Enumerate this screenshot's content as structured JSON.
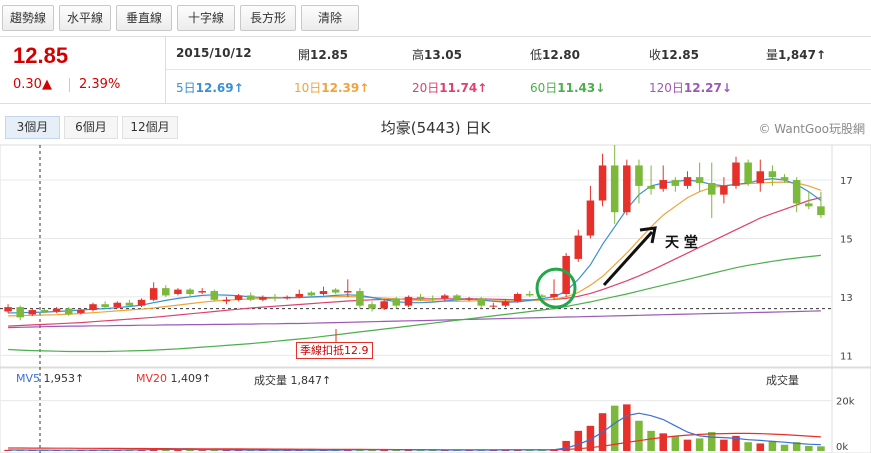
{
  "toolbar": {
    "buttons": [
      "趨勢線",
      "水平線",
      "垂直線",
      "十字線",
      "長方形",
      "清除"
    ]
  },
  "quote": {
    "price": "12.85",
    "change": "0.30▲",
    "change_pct": "2.39%",
    "date": "2015/10/12",
    "open_label": "開",
    "open": "12.85",
    "high_label": "高",
    "high": "13.05",
    "low_label": "低",
    "low": "12.80",
    "close_label": "收",
    "close": "12.85",
    "volume_label": "量",
    "volume": "1,847↑",
    "ma5_label": "5日",
    "ma5": "12.69↑",
    "ma10_label": "10日",
    "ma10": "12.39↑",
    "ma20_label": "20日",
    "ma20": "11.74↑",
    "ma60_label": "60日",
    "ma60": "11.43↓",
    "ma120_label": "120日",
    "ma120": "12.27↓"
  },
  "periods": [
    "3個月",
    "6個月",
    "12個月"
  ],
  "chart_title": "均豪(5443) 日K",
  "watermark": "© WantGoo玩股網",
  "colors": {
    "up": "#e8302a",
    "down": "#7cb83a",
    "ma5": "#3a8fd6",
    "ma10": "#f0a33a",
    "ma20": "#e0406e",
    "ma60": "#4cae4c",
    "ma120": "#9b59b6",
    "vol_ma5": "#3a6fd6",
    "vol_ma20": "#e8302a"
  },
  "chart_data": {
    "type": "candlestick",
    "y_ticks": [
      11,
      13,
      15,
      17
    ],
    "ylim": [
      10.6,
      18.2
    ],
    "vol_ticks": [
      "20k",
      "0k"
    ],
    "vol_max": 25000,
    "candles": [
      [
        12.5,
        12.75,
        12.45,
        12.65
      ],
      [
        12.65,
        12.7,
        12.2,
        12.3
      ],
      [
        12.4,
        12.6,
        12.35,
        12.55
      ],
      [
        12.55,
        12.6,
        12.45,
        12.5
      ],
      [
        12.5,
        12.65,
        12.45,
        12.6
      ],
      [
        12.6,
        12.65,
        12.35,
        12.4
      ],
      [
        12.45,
        12.6,
        12.4,
        12.55
      ],
      [
        12.55,
        12.8,
        12.5,
        12.75
      ],
      [
        12.75,
        12.85,
        12.6,
        12.65
      ],
      [
        12.65,
        12.85,
        12.6,
        12.8
      ],
      [
        12.8,
        12.9,
        12.65,
        12.7
      ],
      [
        12.7,
        12.95,
        12.65,
        12.9
      ],
      [
        12.9,
        13.5,
        12.85,
        13.3
      ],
      [
        13.3,
        13.4,
        13.0,
        13.05
      ],
      [
        13.1,
        13.3,
        13.05,
        13.25
      ],
      [
        13.25,
        13.3,
        13.0,
        13.1
      ],
      [
        13.15,
        13.3,
        13.1,
        13.2
      ],
      [
        13.2,
        13.25,
        12.85,
        12.9
      ],
      [
        12.85,
        13.0,
        12.75,
        12.9
      ],
      [
        12.9,
        13.1,
        12.85,
        13.05
      ],
      [
        13.05,
        13.15,
        12.85,
        12.9
      ],
      [
        12.9,
        13.05,
        12.85,
        13.0
      ],
      [
        13.0,
        13.1,
        12.85,
        12.95
      ],
      [
        12.95,
        13.05,
        12.9,
        13.0
      ],
      [
        13.0,
        13.25,
        12.95,
        13.1
      ],
      [
        13.15,
        13.2,
        13.0,
        13.05
      ],
      [
        13.1,
        13.35,
        13.05,
        13.2
      ],
      [
        13.25,
        13.3,
        13.1,
        13.15
      ],
      [
        13.15,
        13.6,
        13.0,
        13.2
      ],
      [
        13.2,
        13.3,
        12.6,
        12.7
      ],
      [
        12.75,
        12.85,
        12.5,
        12.6
      ],
      [
        12.6,
        12.9,
        12.55,
        12.85
      ],
      [
        12.95,
        13.0,
        12.6,
        12.7
      ],
      [
        12.7,
        13.05,
        12.65,
        13.0
      ],
      [
        13.0,
        13.1,
        12.85,
        12.95
      ],
      [
        12.95,
        13.05,
        12.8,
        12.9
      ],
      [
        12.95,
        13.1,
        12.85,
        13.05
      ],
      [
        13.05,
        13.1,
        12.85,
        12.9
      ],
      [
        12.9,
        13.0,
        12.85,
        12.95
      ],
      [
        12.95,
        13.0,
        12.6,
        12.7
      ],
      [
        12.7,
        12.8,
        12.6,
        12.7
      ],
      [
        12.7,
        12.9,
        12.65,
        12.85
      ],
      [
        12.85,
        13.15,
        12.8,
        13.1
      ],
      [
        13.1,
        13.2,
        13.0,
        13.05
      ],
      [
        13.05,
        13.1,
        12.95,
        13.0
      ],
      [
        13.0,
        13.6,
        12.9,
        13.1
      ],
      [
        13.1,
        14.5,
        13.0,
        14.4
      ],
      [
        14.3,
        15.3,
        14.2,
        15.1
      ],
      [
        15.1,
        16.8,
        15.0,
        16.3
      ],
      [
        16.3,
        17.9,
        16.1,
        17.5
      ],
      [
        17.5,
        18.2,
        15.5,
        15.9
      ],
      [
        15.9,
        17.7,
        15.8,
        17.5
      ],
      [
        17.5,
        17.7,
        16.2,
        16.8
      ],
      [
        16.8,
        17.5,
        16.5,
        16.7
      ],
      [
        16.7,
        17.5,
        16.6,
        17.0
      ],
      [
        17.0,
        17.1,
        16.6,
        16.8
      ],
      [
        16.8,
        17.3,
        16.7,
        17.1
      ],
      [
        17.1,
        17.6,
        16.6,
        16.9
      ],
      [
        16.9,
        17.6,
        15.7,
        16.5
      ],
      [
        16.5,
        17.1,
        16.2,
        16.8
      ],
      [
        16.8,
        17.8,
        16.7,
        17.6
      ],
      [
        17.6,
        17.7,
        16.8,
        16.9
      ],
      [
        16.9,
        17.7,
        16.6,
        17.3
      ],
      [
        17.3,
        17.5,
        16.8,
        17.1
      ],
      [
        17.1,
        17.2,
        16.9,
        17.0
      ],
      [
        17.0,
        17.1,
        15.9,
        16.2
      ],
      [
        16.2,
        16.6,
        16.0,
        16.1
      ],
      [
        16.1,
        16.6,
        15.7,
        15.8
      ]
    ],
    "volumes": [
      450,
      380,
      300,
      250,
      350,
      320,
      300,
      420,
      380,
      350,
      420,
      600,
      900,
      800,
      500,
      400,
      300,
      500,
      400,
      300,
      350,
      380,
      300,
      320,
      400,
      350,
      380,
      350,
      600,
      700,
      500,
      450,
      550,
      500,
      350,
      350,
      380,
      400,
      350,
      500,
      400,
      420,
      500,
      450,
      380,
      700,
      4000,
      8000,
      10000,
      15000,
      18000,
      18500,
      12000,
      8000,
      7000,
      6000,
      4500,
      5000,
      7500,
      4500,
      6000,
      3500,
      3000,
      4000,
      2500,
      3500,
      2000,
      1847
    ],
    "ma5": [
      12.45,
      12.46,
      12.47,
      12.48,
      12.5,
      12.52,
      12.55,
      12.58,
      12.6,
      12.63,
      12.67,
      12.72,
      12.8,
      12.88,
      12.95,
      13.0,
      13.05,
      13.07,
      13.06,
      13.04,
      13.0,
      12.98,
      12.97,
      12.97,
      12.98,
      13.0,
      13.02,
      13.05,
      13.07,
      13.05,
      12.98,
      12.9,
      12.84,
      12.8,
      12.8,
      12.82,
      12.86,
      12.9,
      12.93,
      12.9,
      12.85,
      12.82,
      12.83,
      12.88,
      12.94,
      13.0,
      13.2,
      13.6,
      14.1,
      14.8,
      15.4,
      16.0,
      16.5,
      16.8,
      16.9,
      16.95,
      17.0,
      16.95,
      16.85,
      16.8,
      16.85,
      16.9,
      17.0,
      17.05,
      17.0,
      16.85,
      16.6,
      16.3
    ],
    "ma10": [
      12.35,
      12.36,
      12.37,
      12.38,
      12.39,
      12.41,
      12.43,
      12.46,
      12.49,
      12.52,
      12.55,
      12.58,
      12.62,
      12.67,
      12.72,
      12.77,
      12.82,
      12.86,
      12.89,
      12.91,
      12.93,
      12.95,
      12.96,
      12.97,
      12.98,
      12.99,
      13.0,
      13.01,
      13.01,
      13.0,
      12.98,
      12.96,
      12.93,
      12.9,
      12.88,
      12.86,
      12.85,
      12.85,
      12.86,
      12.87,
      12.87,
      12.86,
      12.86,
      12.87,
      12.89,
      12.92,
      13.0,
      13.15,
      13.4,
      13.7,
      14.1,
      14.5,
      14.95,
      15.4,
      15.8,
      16.1,
      16.4,
      16.6,
      16.75,
      16.8,
      16.85,
      16.88,
      16.9,
      16.92,
      16.93,
      16.9,
      16.8,
      16.65
    ],
    "ma20": [
      12.0,
      12.02,
      12.04,
      12.06,
      12.08,
      12.1,
      12.12,
      12.15,
      12.18,
      12.21,
      12.24,
      12.27,
      12.3,
      12.34,
      12.38,
      12.42,
      12.46,
      12.5,
      12.54,
      12.58,
      12.62,
      12.65,
      12.68,
      12.71,
      12.74,
      12.77,
      12.8,
      12.83,
      12.86,
      12.88,
      12.9,
      12.91,
      12.92,
      12.93,
      12.93,
      12.93,
      12.93,
      12.93,
      12.93,
      12.93,
      12.92,
      12.91,
      12.9,
      12.9,
      12.9,
      12.91,
      12.95,
      13.02,
      13.12,
      13.25,
      13.4,
      13.55,
      13.72,
      13.9,
      14.1,
      14.3,
      14.5,
      14.7,
      14.9,
      15.1,
      15.3,
      15.5,
      15.7,
      15.85,
      16.0,
      16.15,
      16.3,
      16.4
    ],
    "ma60": [
      11.2,
      11.18,
      11.16,
      11.15,
      11.14,
      11.13,
      11.13,
      11.13,
      11.13,
      11.14,
      11.15,
      11.16,
      11.18,
      11.2,
      11.22,
      11.25,
      11.28,
      11.31,
      11.34,
      11.37,
      11.4,
      11.44,
      11.48,
      11.52,
      11.56,
      11.6,
      11.65,
      11.7,
      11.75,
      11.8,
      11.85,
      11.9,
      11.95,
      12.0,
      12.05,
      12.1,
      12.15,
      12.2,
      12.25,
      12.3,
      12.35,
      12.4,
      12.45,
      12.5,
      12.55,
      12.6,
      12.67,
      12.75,
      12.83,
      12.92,
      13.01,
      13.1,
      13.2,
      13.3,
      13.4,
      13.5,
      13.6,
      13.7,
      13.8,
      13.9,
      14.0,
      14.08,
      14.15,
      14.22,
      14.28,
      14.33,
      14.38,
      14.42
    ],
    "ma120": [
      11.95,
      11.96,
      11.97,
      11.98,
      11.99,
      12.0,
      12.0,
      12.01,
      12.01,
      12.02,
      12.02,
      12.03,
      12.03,
      12.04,
      12.04,
      12.05,
      12.05,
      12.06,
      12.06,
      12.07,
      12.07,
      12.08,
      12.08,
      12.09,
      12.09,
      12.1,
      12.11,
      12.12,
      12.13,
      12.14,
      12.15,
      12.16,
      12.17,
      12.18,
      12.19,
      12.2,
      12.21,
      12.22,
      12.23,
      12.24,
      12.25,
      12.26,
      12.27,
      12.28,
      12.29,
      12.3,
      12.31,
      12.32,
      12.33,
      12.34,
      12.35,
      12.36,
      12.37,
      12.38,
      12.39,
      12.4,
      12.41,
      12.42,
      12.43,
      12.44,
      12.45,
      12.46,
      12.47,
      12.48,
      12.49,
      12.5,
      12.51,
      12.52
    ],
    "vma5": [
      400,
      380,
      360,
      340,
      330,
      320,
      330,
      340,
      350,
      360,
      380,
      420,
      500,
      600,
      650,
      600,
      550,
      500,
      450,
      400,
      380,
      370,
      350,
      340,
      340,
      350,
      360,
      370,
      420,
      480,
      520,
      520,
      500,
      480,
      450,
      420,
      400,
      390,
      380,
      400,
      410,
      420,
      440,
      450,
      450,
      500,
      1200,
      2600,
      4600,
      7500,
      11000,
      14000,
      15000,
      14000,
      12500,
      10000,
      7500,
      6000,
      5500,
      5300,
      5000,
      4500,
      4200,
      3800,
      3500,
      3000,
      2700,
      2500
    ],
    "vma20": [
      1200,
      1180,
      1160,
      1140,
      1120,
      1100,
      1080,
      1060,
      1040,
      1020,
      1000,
      980,
      960,
      940,
      920,
      900,
      880,
      860,
      840,
      820,
      800,
      780,
      760,
      740,
      720,
      700,
      680,
      660,
      640,
      620,
      600,
      580,
      560,
      540,
      520,
      500,
      490,
      480,
      470,
      460,
      450,
      450,
      450,
      450,
      450,
      460,
      600,
      900,
      1300,
      1900,
      2600,
      3400,
      4100,
      4800,
      5400,
      5900,
      6300,
      6600,
      6800,
      6900,
      7000,
      7000,
      6900,
      6700,
      6500,
      6200,
      5900,
      5600
    ],
    "support_line": 12.6,
    "callout": "季線扣抵12.9",
    "annotation": "天 堂",
    "vol_legend": {
      "mv5_label": "MV5",
      "mv5": "1,953↑",
      "mv20_label": "MV20",
      "mv20": "1,409↑",
      "vol_label": "成交量",
      "vol": "1,847↑",
      "right_label": "成交量"
    }
  }
}
